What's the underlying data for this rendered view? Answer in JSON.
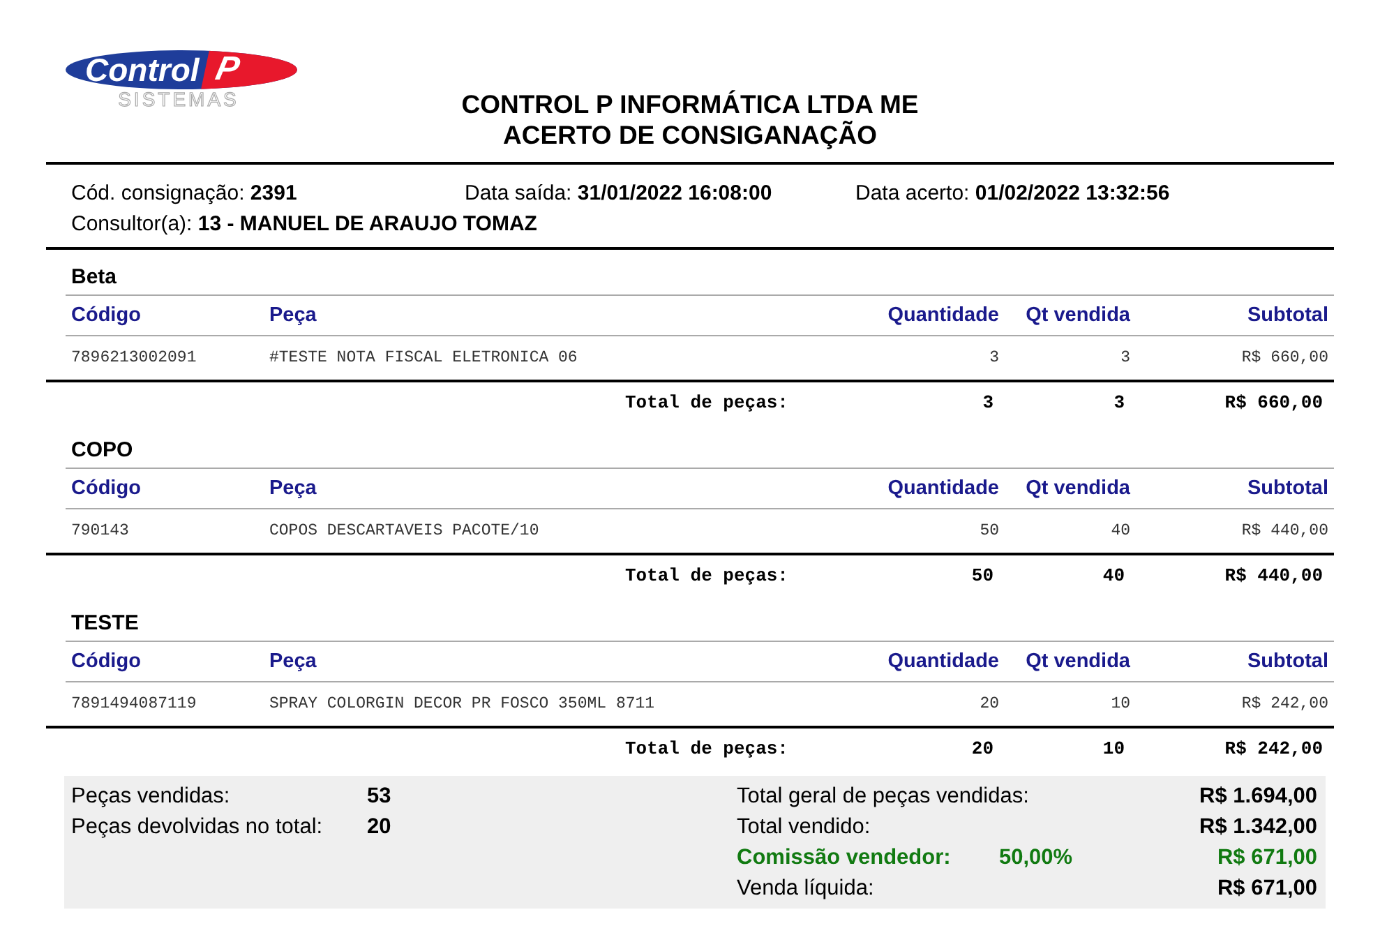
{
  "logo": {
    "word": "Control",
    "letter": "P",
    "tagline": "SISTEMAS"
  },
  "title": [
    "CONTROL P INFORMÁTICA LTDA ME",
    "ACERTO DE CONSIGANAÇÃO"
  ],
  "info": [
    [
      {
        "label": "Cód. consignação:",
        "value": "2391"
      },
      {
        "label": "Data saída:",
        "value": "31/01/2022 16:08:00"
      },
      {
        "label": "Data acerto:",
        "value": "01/02/2022 13:32:56"
      }
    ],
    [
      {
        "label": "Consultor(a):",
        "value": "13 - MANUEL DE ARAUJO TOMAZ"
      }
    ]
  ],
  "groups": [
    {
      "name": "Beta",
      "columns": [
        "Código",
        "Peça",
        "Quantidade",
        "Qt vendida",
        "Subtotal"
      ],
      "rows": [
        [
          "7896213002091",
          "#TESTE NOTA FISCAL ELETRONICA 06",
          "3",
          "3",
          "R$ 660,00"
        ]
      ],
      "total": {
        "label": "Total de peças:",
        "quantity": "3",
        "sold": "3",
        "subtotal": "R$ 660,00"
      }
    },
    {
      "name": "COPO",
      "columns": [
        "Código",
        "Peça",
        "Quantidade",
        "Qt vendida",
        "Subtotal"
      ],
      "rows": [
        [
          "790143",
          "COPOS DESCARTAVEIS PACOTE/10",
          "50",
          "40",
          "R$ 440,00"
        ]
      ],
      "total": {
        "label": "Total de peças:",
        "quantity": "50",
        "sold": "40",
        "subtotal": "R$ 440,00"
      }
    },
    {
      "name": "TESTE",
      "columns": [
        "Código",
        "Peça",
        "Quantidade",
        "Qt vendida",
        "Subtotal"
      ],
      "rows": [
        [
          "7891494087119",
          "SPRAY COLORGIN DECOR PR FOSCO 350ML 8711",
          "20",
          "10",
          "R$ 242,00"
        ]
      ],
      "total": {
        "label": "Total de peças:",
        "quantity": "20",
        "sold": "10",
        "subtotal": "R$ 242,00"
      }
    }
  ],
  "summary": {
    "left": [
      {
        "label": "Peças vendidas:",
        "value": "53"
      },
      {
        "label": "Peças devolvidas no total:",
        "value": "20"
      }
    ],
    "right": [
      {
        "kind": "plain",
        "label": "Total geral de peças vendidas:",
        "value": "R$ 1.694,00"
      },
      {
        "kind": "plain",
        "label": "Total vendido:",
        "value": "R$ 1.342,00"
      },
      {
        "kind": "commission",
        "label": "Comissão vendedor:",
        "rate": "50,00%",
        "value": "R$ 671,00"
      },
      {
        "kind": "plain",
        "label": "Venda líquida:",
        "value": "R$ 671,00"
      }
    ]
  }
}
